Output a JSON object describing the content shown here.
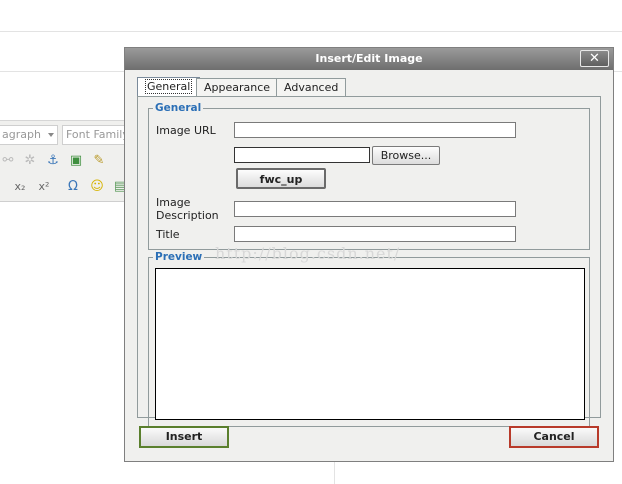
{
  "editor": {
    "format_select": "agraph",
    "font_select": "Font Family"
  },
  "dialog": {
    "title": "Insert/Edit Image",
    "close_label": "✕",
    "tabs": [
      {
        "label": "General"
      },
      {
        "label": "Appearance"
      },
      {
        "label": "Advanced"
      }
    ],
    "general": {
      "legend": "General",
      "image_url_label": "Image URL",
      "image_url_value": "",
      "file_value": "",
      "browse_label": "Browse...",
      "upload_label": "fwc_up",
      "image_desc_label_1": "Image",
      "image_desc_label_2": "Description",
      "image_desc_value": "",
      "title_label": "Title",
      "title_value": ""
    },
    "preview": {
      "legend": "Preview"
    },
    "insert_label": "Insert",
    "cancel_label": "Cancel"
  },
  "watermark": "http://blog.csdn.net/",
  "colors": {
    "legend": "#2b6fb6",
    "insert_border": "#5a7f2d",
    "cancel_border": "#b83a2a"
  }
}
